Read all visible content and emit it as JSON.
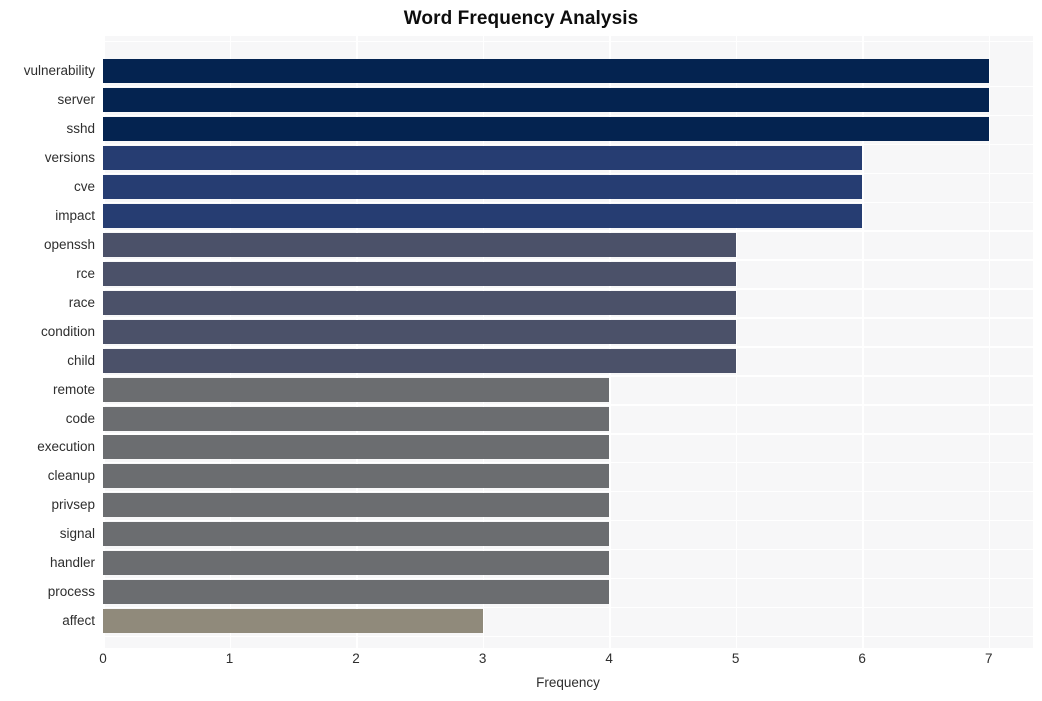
{
  "chart_data": {
    "type": "bar",
    "orientation": "horizontal",
    "title": "Word Frequency Analysis",
    "xlabel": "Frequency",
    "ylabel": "",
    "xlim": [
      0,
      7.35
    ],
    "xticks": [
      0,
      1,
      2,
      3,
      4,
      5,
      6,
      7
    ],
    "xtick_labels": [
      "0",
      "1",
      "2",
      "3",
      "4",
      "5",
      "6",
      "7"
    ],
    "grid": true,
    "legend": "none",
    "categories": [
      "vulnerability",
      "server",
      "sshd",
      "versions",
      "cve",
      "impact",
      "openssh",
      "rce",
      "race",
      "condition",
      "child",
      "remote",
      "code",
      "execution",
      "cleanup",
      "privsep",
      "signal",
      "handler",
      "process",
      "affect"
    ],
    "values": [
      7,
      7,
      7,
      6,
      6,
      6,
      5,
      5,
      5,
      5,
      5,
      4,
      4,
      4,
      4,
      4,
      4,
      4,
      4,
      3
    ],
    "bar_colors": [
      "#042350",
      "#042350",
      "#042350",
      "#263d72",
      "#263d72",
      "#263d72",
      "#4b5169",
      "#4b5169",
      "#4b5169",
      "#4b5169",
      "#4b5169",
      "#6b6d70",
      "#6b6d70",
      "#6b6d70",
      "#6b6d70",
      "#6b6d70",
      "#6b6d70",
      "#6b6d70",
      "#6b6d70",
      "#908a7b"
    ]
  },
  "style": {
    "plot_background": "#f7f7f8",
    "grid_color": "#ffffff",
    "page_background": "#ffffff",
    "text_color": "#2e2e2e",
    "title_color": "#0d0d0d"
  }
}
